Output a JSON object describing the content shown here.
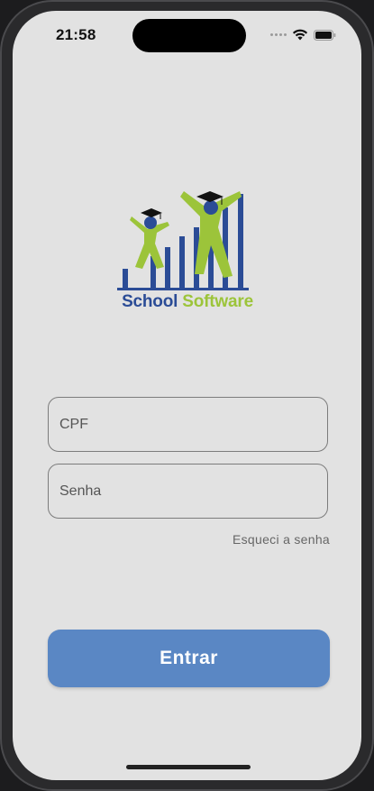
{
  "status_bar": {
    "time": "21:58",
    "icons": [
      "signal-dots-icon",
      "wifi-icon",
      "battery-icon"
    ]
  },
  "logo": {
    "word1": "School",
    "word2": "Software",
    "colors": {
      "blue": "#2b4c96",
      "green": "#9cc43a"
    }
  },
  "form": {
    "cpf_placeholder": "CPF",
    "senha_placeholder": "Senha",
    "forgot_label": "Esqueci a senha"
  },
  "actions": {
    "enter_label": "Entrar"
  },
  "colors": {
    "background": "#e2e2e2",
    "button": "#5a87c4",
    "field_border": "#7c7c7c"
  }
}
